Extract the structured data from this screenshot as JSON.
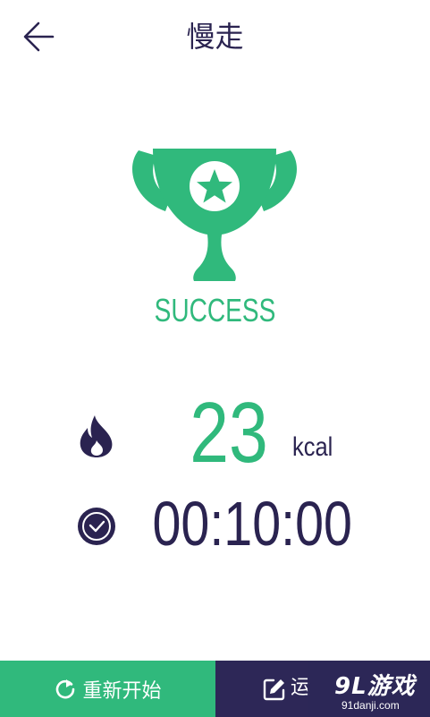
{
  "header": {
    "title": "慢走",
    "back_icon": "arrow-left-icon"
  },
  "result": {
    "status_text": "SUCCESS",
    "icon": "trophy-icon"
  },
  "stats": {
    "calories": {
      "icon": "flame-icon",
      "value": "23",
      "unit": "kcal"
    },
    "duration": {
      "icon": "clock-check-icon",
      "value": "00:10:00"
    }
  },
  "actions": {
    "restart": {
      "icon": "refresh-icon",
      "label": "重新开始"
    },
    "record": {
      "icon": "edit-icon",
      "label": "运"
    }
  },
  "watermark": {
    "logo": "9L游戏",
    "url": "91danji.com"
  },
  "colors": {
    "accent": "#30b97c",
    "dark": "#2d2757",
    "text": "#2a2350",
    "background": "#ffffff"
  }
}
